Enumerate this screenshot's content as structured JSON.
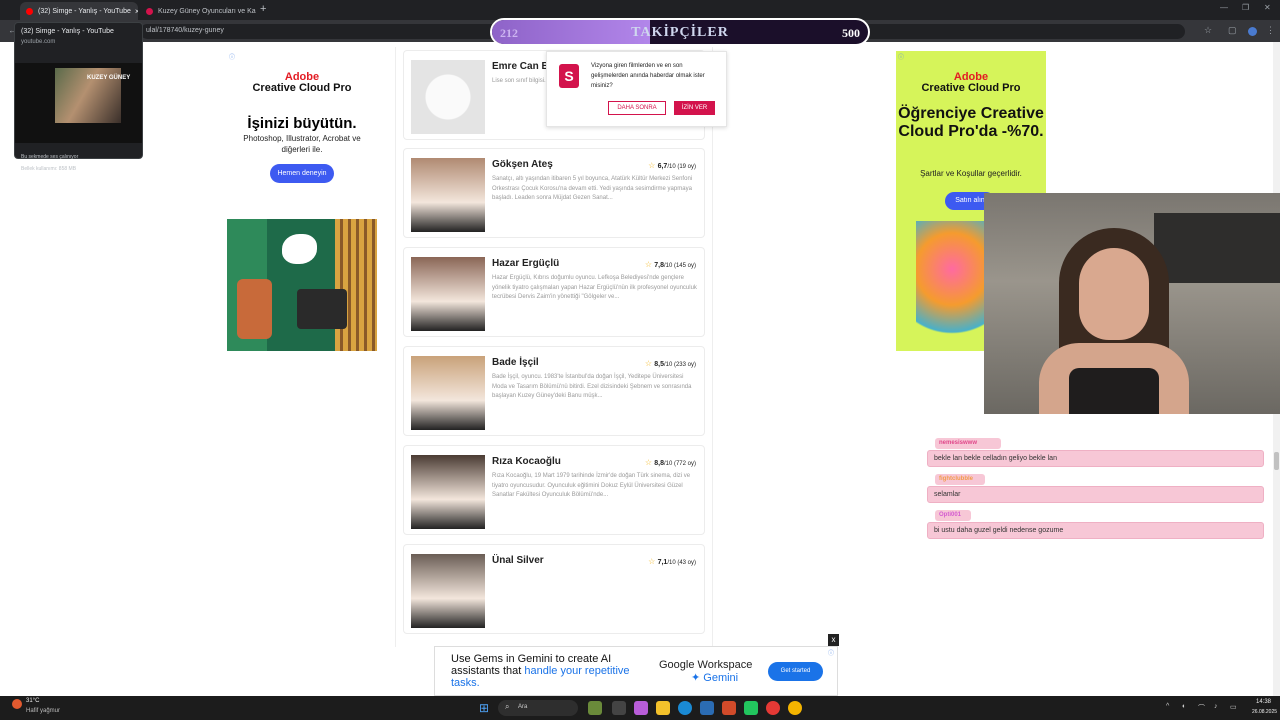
{
  "browser": {
    "tabs": [
      {
        "title": "(32) Simge - Yanlış - YouTube",
        "active": true
      },
      {
        "title": "Kuzey Güney Oyuncuları ve Ka",
        "active": false
      }
    ],
    "url": "ulal/178740/kuzey-guney",
    "new_tab": "+"
  },
  "tab_preview": {
    "title": "(32) Simge - Yanlış - YouTube",
    "domain": "youtube.com",
    "poster_title": "KUZEY GÜNEY",
    "info_audio": "Bu sekmede ses çalınıyor",
    "info_memory": "Bellek kullanımı: 858 MB"
  },
  "followers": {
    "current": "212",
    "label": "TAKİPÇİLER",
    "goal": "500",
    "progress": 0.42
  },
  "ad_left": {
    "brand": "Adobe",
    "product": "Creative Cloud Pro",
    "headline": "İşinizi büyütün.",
    "sub": "Photoshop, Illustrator, Acrobat ve diğerleri ile.",
    "cta": "Hemen deneyin"
  },
  "ad_right": {
    "brand": "Adobe",
    "product": "Creative Cloud Pro",
    "headline": "Öğrenciye Creative Cloud Pro'da -%70.",
    "sub": "Şartlar ve Koşullar geçerlidir.",
    "cta": "Satın alın"
  },
  "notification": {
    "message": "Vizyona giren filmlerden ve en son gelişmelerden anında haberdar olmak ister misiniz?",
    "later": "DAHA SONRA",
    "allow": "İZİN VER",
    "logo": "S"
  },
  "actors": [
    {
      "name": "Emre Can B",
      "rating": "",
      "votes": "",
      "bio": "Lise son sınıf bilgisi... sosyal medya platf... Eylül 1999 tarihinde...",
      "photo_color": "#ececec"
    },
    {
      "name": "Gökşen Ateş",
      "rating": "6,7",
      "votes": "/10 (19 oy)",
      "bio": "Sanatçı, altı yaşından itibaren 5 yıl boyunca, Atatürk Kültür Merkezi Senfoni Orkestrası Çocuk Korosu'na devam etti. Yedi yaşında sesimdirme yapmaya başladı. Leaden sonra Müjdat Gezen Sanat...",
      "photo_color": "#b08a72"
    },
    {
      "name": "Hazar Ergüçlü",
      "rating": "7,8",
      "votes": "/10 (145 oy)",
      "bio": "Hazar Ergüçlü, Kıbrıs doğumlu oyuncu. Lefkoşa Belediyesi'nde gençlere yönelik tiyatro çalışmaları yapan Hazar Ergüçlü'nün ilk profesyonel oyunculuk tecrübesi Dervis Zaim'in yönettiği \"Gölgeler ve...",
      "photo_color": "#8a6656"
    },
    {
      "name": "Bade İşçil",
      "rating": "8,5",
      "votes": "/10 (233 oy)",
      "bio": "Bade İşçil, oyuncu. 1983'te İstanbul'da doğan İşçil, Yeditepe Üniversitesi Moda ve Tasarım Bölümü'nü bitirdi. Ezel dizisindeki Şebnem ve sonrasında başlayan Kuzey Güney'deki Banu müşk...",
      "photo_color": "#c9a27a"
    },
    {
      "name": "Rıza Kocaoğlu",
      "rating": "8,8",
      "votes": "/10 (772 oy)",
      "bio": "Rıza Kocaoğlu, 19 Mart 1979 tarihinde İzmir'de doğan Türk sinema, dizi ve tiyatro oyuncusudur. Oyunculuk eğitimini Dokuz Eylül Üniversitesi Güzel Sanatlar Fakültesi Oyunculuk Bölümü'nde...",
      "photo_color": "#4a3b33"
    },
    {
      "name": "Ünal Silver",
      "rating": "7,1",
      "votes": "/10 (43 oy)",
      "bio": "",
      "photo_color": "#6a5d55"
    }
  ],
  "chat": [
    {
      "user": "nemesiswww",
      "message": "bekle lan bekle celladın geliyo bekle lan",
      "user_color": "#e0478a"
    },
    {
      "user": "fightclubble",
      "message": "selamlar",
      "user_color": "#f29b4a"
    },
    {
      "user": "Opti001",
      "message": "bi ustu daha guzel geldi nedense gozume",
      "user_color": "#d45bd0"
    }
  ],
  "ad_bottom": {
    "line_plain": "Use Gems in Gemini to create AI assistants that ",
    "line_blue": "handle your repetitive tasks.",
    "brand": "Google Workspace",
    "product": "Gemini",
    "cta": "Get started",
    "close": "x"
  },
  "taskbar": {
    "weather_temp": "31°C",
    "weather_desc": "Hafif yağmur",
    "search_placeholder": "Ara",
    "time": "14:38",
    "date": "26.08.2025"
  }
}
